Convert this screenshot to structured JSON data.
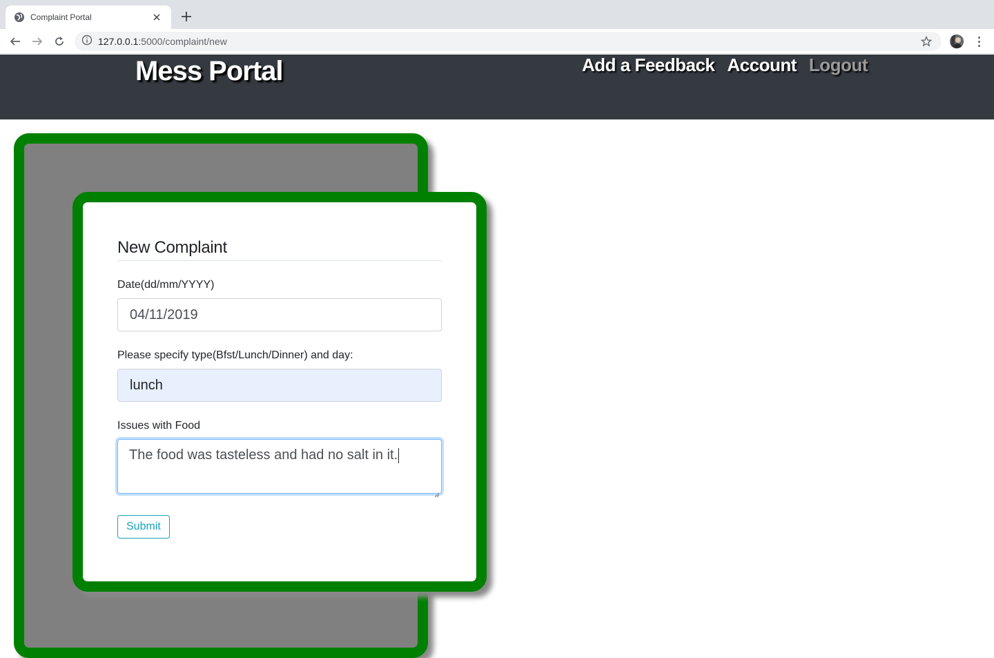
{
  "browser": {
    "tab_title": "Complaint Portal",
    "url_host": "127.0.0.1",
    "url_path": ":5000/complaint/new"
  },
  "navbar": {
    "brand": "Mess Portal",
    "links": [
      "Add a Feedback",
      "Account",
      "Logout"
    ]
  },
  "form": {
    "legend": "New Complaint",
    "date_label": "Date(dd/mm/YYYY)",
    "date_value": "04/11/2019",
    "type_label": "Please specify type(Bfst/Lunch/Dinner) and day:",
    "type_value": "lunch",
    "issues_label": "Issues with Food",
    "issues_value": "The food was tasteless and had no salt in it.",
    "submit_label": "Submit"
  },
  "colors": {
    "card_border": "#008000",
    "card_back": "#808080",
    "navbar_bg": "#343a40",
    "submit_accent": "#17a2b8",
    "autofill_bg": "#e8f0fe"
  },
  "icons": [
    "globe-favicon-icon",
    "close-icon",
    "plus-icon",
    "back-arrow-icon",
    "forward-arrow-icon",
    "reload-icon",
    "info-icon",
    "star-icon",
    "profile-avatar",
    "more-vert-icon"
  ]
}
